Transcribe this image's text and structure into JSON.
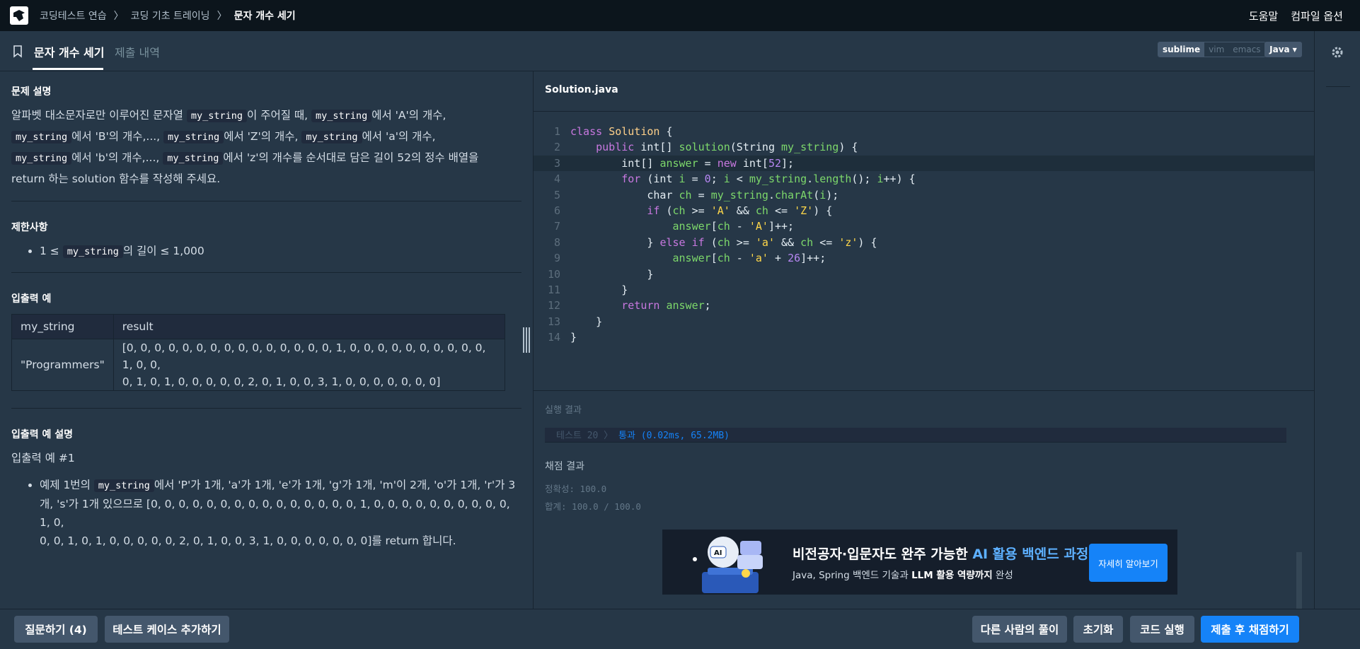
{
  "breadcrumbs": [
    "코딩테스트 연습",
    "코딩 기초 트레이닝",
    "문자 개수 세기"
  ],
  "header_links": [
    "도움말",
    "컴파일 옵션"
  ],
  "tabs": {
    "problem": "문자 개수 세기",
    "submissions": "제출 내역"
  },
  "editor_modes": [
    "sublime",
    "vim",
    "emacs"
  ],
  "language": "Java",
  "problem": {
    "desc_title": "문제 설명",
    "desc": {
      "t1": "알파벳 대소문자로만 이루어진 문자열 ",
      "c1": "my_string",
      "t2": "이 주어질 때, ",
      "c2": "my_string",
      "t3": "에서 'A'의 개수,",
      "c3": "my_string",
      "t4": "에서 'B'의 개수,..., ",
      "c4": "my_string",
      "t5": "에서 'Z'의 개수, ",
      "c5": "my_string",
      "t6": "에서 'a'의 개수,",
      "c6": "my_string",
      "t7": "에서 'b'의 개수,..., ",
      "c7": "my_string",
      "t8": "에서 'z'의 개수를 순서대로 담은 길이 52의 정수 배열을",
      "t9": "return 하는 solution 함수를 작성해 주세요."
    },
    "constraints_title": "제한사항",
    "constraint": {
      "pre": "1 ≤ ",
      "code": "my_string",
      "post": "의 길이 ≤ 1,000"
    },
    "io_title": "입출력 예",
    "io_headers": [
      "my_string",
      "result"
    ],
    "io_row": {
      "input": "\"Programmers\"",
      "result_l1": "[0, 0, 0, 0, 0, 0, 0, 0, 0, 0, 0, 0, 0, 0, 0, 1, 0, 0, 0, 0, 0, 0, 0, 0, 0, 0, 1, 0, 0,",
      "result_l2": "0, 1, 0, 1, 0, 0, 0, 0, 0, 2, 0, 1, 0, 0, 3, 1, 0, 0, 0, 0, 0, 0, 0]"
    },
    "explain_title": "입출력 예 설명",
    "explain_sub": "입출력 예 #1",
    "explain": {
      "pre": "예제 1번의 ",
      "code": "my_string",
      "l1": "에서 'P'가 1개, 'a'가 1개, 'e'가 1개, 'g'가 1개, 'm'이 2개, 'o'가 1개, 'r'가 3",
      "l2": "개, 's'가 1개 있으므로 [0, 0, 0, 0, 0, 0, 0, 0, 0, 0, 0, 0, 0, 0, 0, 1, 0, 0, 0, 0, 0, 0, 0, 0, 0, 0, 1, 0,",
      "l3": "0, 0, 1, 0, 1, 0, 0, 0, 0, 0, 2, 0, 1, 0, 0, 3, 1, 0, 0, 0, 0, 0, 0, 0]를 return 합니다."
    }
  },
  "editor": {
    "filename": "Solution.java",
    "line_numbers": [
      "1",
      "2",
      "3",
      "4",
      "5",
      "6",
      "7",
      "8",
      "9",
      "10",
      "11",
      "12",
      "13",
      "14"
    ],
    "lines": [
      "class Solution {",
      "    public int[] solution(String my_string) {",
      "        int[] answer = new int[52];",
      "        for (int i = 0; i < my_string.length(); i++) {",
      "            char ch = my_string.charAt(i);",
      "            if (ch >= 'A' && ch <= 'Z') {",
      "                answer[ch - 'A']++;",
      "            } else if (ch >= 'a' && ch <= 'z') {",
      "                answer[ch - 'a' + 26]++;",
      "            }",
      "        }",
      "        return answer;",
      "    }",
      "}"
    ]
  },
  "result": {
    "label": "실행 결과",
    "test_row": "테스트 20 〉",
    "test_pass": "통과 (0.02ms, 65.2MB)",
    "grade_title": "채점 결과",
    "accuracy": "정확성: 100.0",
    "total": "합계: 100.0 / 100.0"
  },
  "ad": {
    "title_pre": "비전공자·입문자도 완주 가능한 ",
    "title_hl": "AI 활용 백엔드 과정",
    "sub_pre": "Java, Spring 백엔드 기술과 ",
    "sub_bold": "LLM 활용 역량까지",
    "sub_post": " 완성",
    "button": "자세히 알아보기",
    "badge": "AI"
  },
  "bottom": {
    "ask": "질문하기 (4)",
    "add_test": "테스트 케이스 추가하기",
    "others": "다른 사람의 풀이",
    "reset": "초기화",
    "run": "코드 실행",
    "submit": "제출 후 채점하기"
  },
  "colors": {
    "accent": "#1583f8",
    "bg": "#263747",
    "topbar": "#0c151c"
  }
}
